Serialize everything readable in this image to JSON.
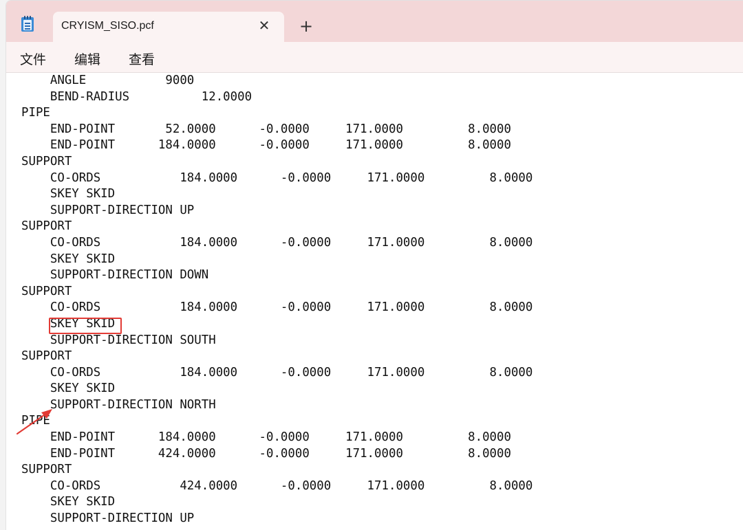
{
  "window": {
    "tab_title": "CRYISM_SISO.pcf",
    "tab_close_glyph": "✕",
    "new_tab_glyph": "+"
  },
  "menu": [
    "文件",
    "编辑",
    "查看"
  ],
  "editor": {
    "lines": [
      "    ANGLE           9000",
      "    BEND-RADIUS          12.0000",
      "PIPE",
      "    END-POINT       52.0000      -0.0000     171.0000         8.0000",
      "    END-POINT      184.0000      -0.0000     171.0000         8.0000",
      "SUPPORT",
      "    CO-ORDS           184.0000      -0.0000     171.0000         8.0000",
      "    SKEY SKID",
      "    SUPPORT-DIRECTION UP",
      "SUPPORT",
      "    CO-ORDS           184.0000      -0.0000     171.0000         8.0000",
      "    SKEY SKID",
      "    SUPPORT-DIRECTION DOWN",
      "SUPPORT",
      "    CO-ORDS           184.0000      -0.0000     171.0000         8.0000",
      "    SKEY SKID",
      "    SUPPORT-DIRECTION SOUTH",
      "SUPPORT",
      "    CO-ORDS           184.0000      -0.0000     171.0000         8.0000",
      "    SKEY SKID",
      "    SUPPORT-DIRECTION NORTH",
      "PIPE",
      "    END-POINT      184.0000      -0.0000     171.0000         8.0000",
      "    END-POINT      424.0000      -0.0000     171.0000         8.0000",
      "SUPPORT",
      "    CO-ORDS           424.0000      -0.0000     171.0000         8.0000",
      "    SKEY SKID",
      "    SUPPORT-DIRECTION UP"
    ]
  },
  "annotation": {
    "color": "#e23b35",
    "highlighted_text": "SKEY SKID"
  },
  "icons": {
    "app": "notepad-icon",
    "close": "close-icon",
    "new_tab": "plus-icon"
  }
}
